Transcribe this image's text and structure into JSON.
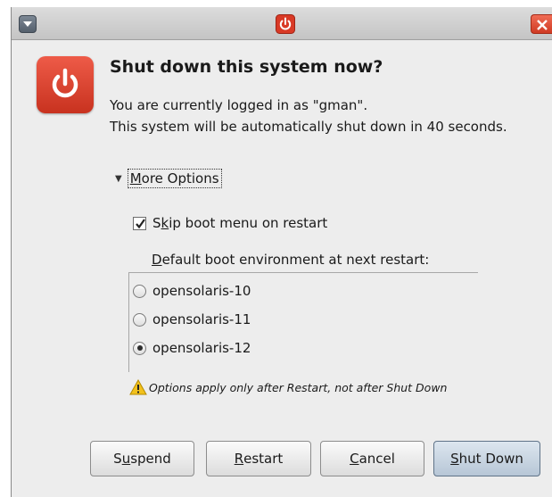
{
  "dialog": {
    "heading": "Shut down this system now?",
    "message_line1": "You are currently logged in as \"gman\".",
    "message_line2": "This system will be automatically shut down in 40 seconds."
  },
  "options": {
    "expander_prefix": "",
    "expander_underlined": "M",
    "expander_rest": "ore Options",
    "skip_boot_pre": "S",
    "skip_boot_ul": "k",
    "skip_boot_post": "ip boot menu on restart",
    "skip_boot_checked": true,
    "group_ul": "D",
    "group_rest": "efault boot environment at next restart:",
    "boot_environments": [
      {
        "label": "opensolaris-10",
        "selected": false
      },
      {
        "label": "opensolaris-11",
        "selected": false
      },
      {
        "label": "opensolaris-12",
        "selected": true
      }
    ],
    "note": "Options apply only after Restart, not after Shut Down"
  },
  "buttons": {
    "suspend_pre": "S",
    "suspend_ul": "u",
    "suspend_post": "spend",
    "restart_ul": "R",
    "restart_post": "estart",
    "cancel_ul": "C",
    "cancel_post": "ancel",
    "shutdown_ul": "S",
    "shutdown_post": "hut Down"
  },
  "colors": {
    "power_red": "#d93a26",
    "window_bg": "#ededed",
    "warning_yellow": "#f2c11c"
  },
  "icons": {
    "window_menu": "window-menu-icon",
    "title_power": "power-icon",
    "close": "close-icon",
    "dialog_power": "power-icon",
    "expander": "triangle-down-icon",
    "note": "warning-icon"
  }
}
